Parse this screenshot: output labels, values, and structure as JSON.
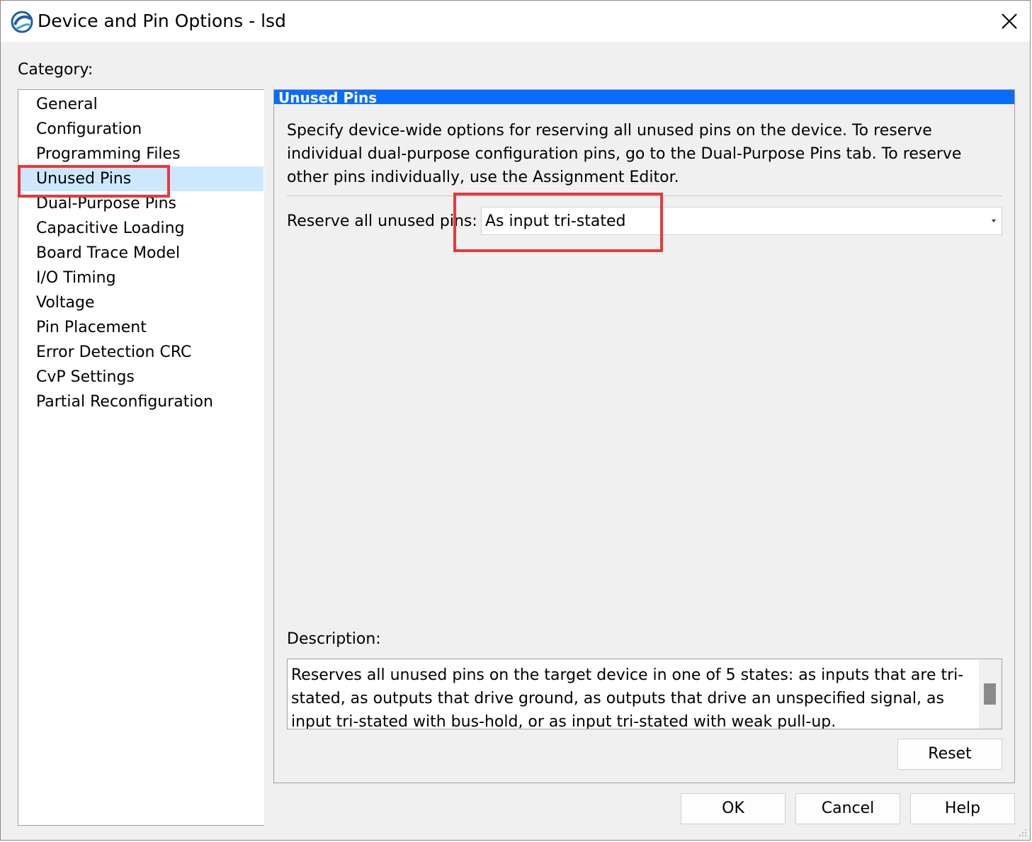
{
  "window": {
    "title": "Device and Pin Options - lsd",
    "icons": {
      "app": "quartus-globe-icon",
      "close": "close-icon"
    }
  },
  "category": {
    "label": "Category:",
    "selected": "Unused Pins",
    "items": [
      "General",
      "Configuration",
      "Programming Files",
      "Unused Pins",
      "Dual-Purpose Pins",
      "Capacitive Loading",
      "Board Trace Model",
      "I/O Timing",
      "Voltage",
      "Pin Placement",
      "Error Detection CRC",
      "CvP Settings",
      "Partial Reconfiguration"
    ]
  },
  "panel": {
    "header": "Unused Pins",
    "intro": "Specify device-wide options for reserving all unused pins on the device. To reserve individual dual-purpose configuration pins, go to the Dual-Purpose Pins tab. To reserve other pins individually, use the Assignment Editor.",
    "reserve_label": "Reserve all unused pins:",
    "reserve_value": "As input tri-stated",
    "description_label": "Description:",
    "description_text": "Reserves all unused pins on the target device in one of 5 states: as inputs that are tri-stated, as outputs that drive ground, as outputs that drive an unspecified signal, as input tri-stated with bus-hold, or as input tri-stated with weak pull-up.",
    "reset_label": "Reset"
  },
  "buttons": {
    "ok": "OK",
    "cancel": "Cancel",
    "help": "Help"
  },
  "colors": {
    "header_bg": "#0a6cff",
    "selection_bg": "#cce8ff",
    "annotation_red": "#e8383d"
  }
}
